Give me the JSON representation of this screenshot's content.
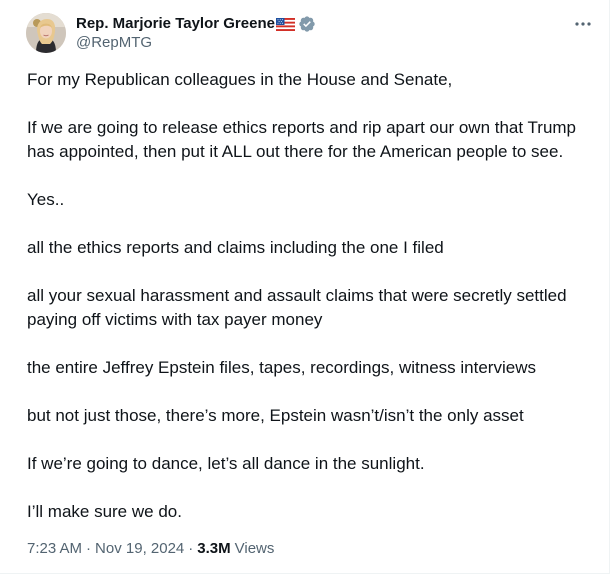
{
  "author": {
    "display_name": "Rep. Marjorie Taylor Greene",
    "handle": "@RepMTG",
    "flag_icon": "us-flag-icon",
    "verified_icon": "verified-badge-icon",
    "verified_color": "#829aab"
  },
  "more_icon": "more-horizontal-icon",
  "tweet": {
    "paragraphs": [
      "For my Republican colleagues in the House and Senate,",
      "If we are going to release ethics reports and rip apart our own that Trump has appointed, then put it ALL out there for the American people to see.",
      "Yes..",
      "all the ethics reports and claims including the one I filed",
      "all your sexual harassment and assault claims that were secretly settled paying off victims with tax payer money",
      "the entire Jeffrey Epstein files, tapes, recordings, witness interviews",
      "but not just those, there’s more, Epstein wasn’t/isn’t the only asset",
      "If we’re going to dance, let’s all dance in the sunlight.",
      "I’ll make sure we do."
    ]
  },
  "meta": {
    "time": "7:23 AM",
    "separator": "·",
    "date": "Nov 19, 2024",
    "views_count": "3.3M",
    "views_label": "Views"
  },
  "colors": {
    "text_primary": "#0f1419",
    "text_secondary": "#536471",
    "border": "#eff3f4"
  }
}
